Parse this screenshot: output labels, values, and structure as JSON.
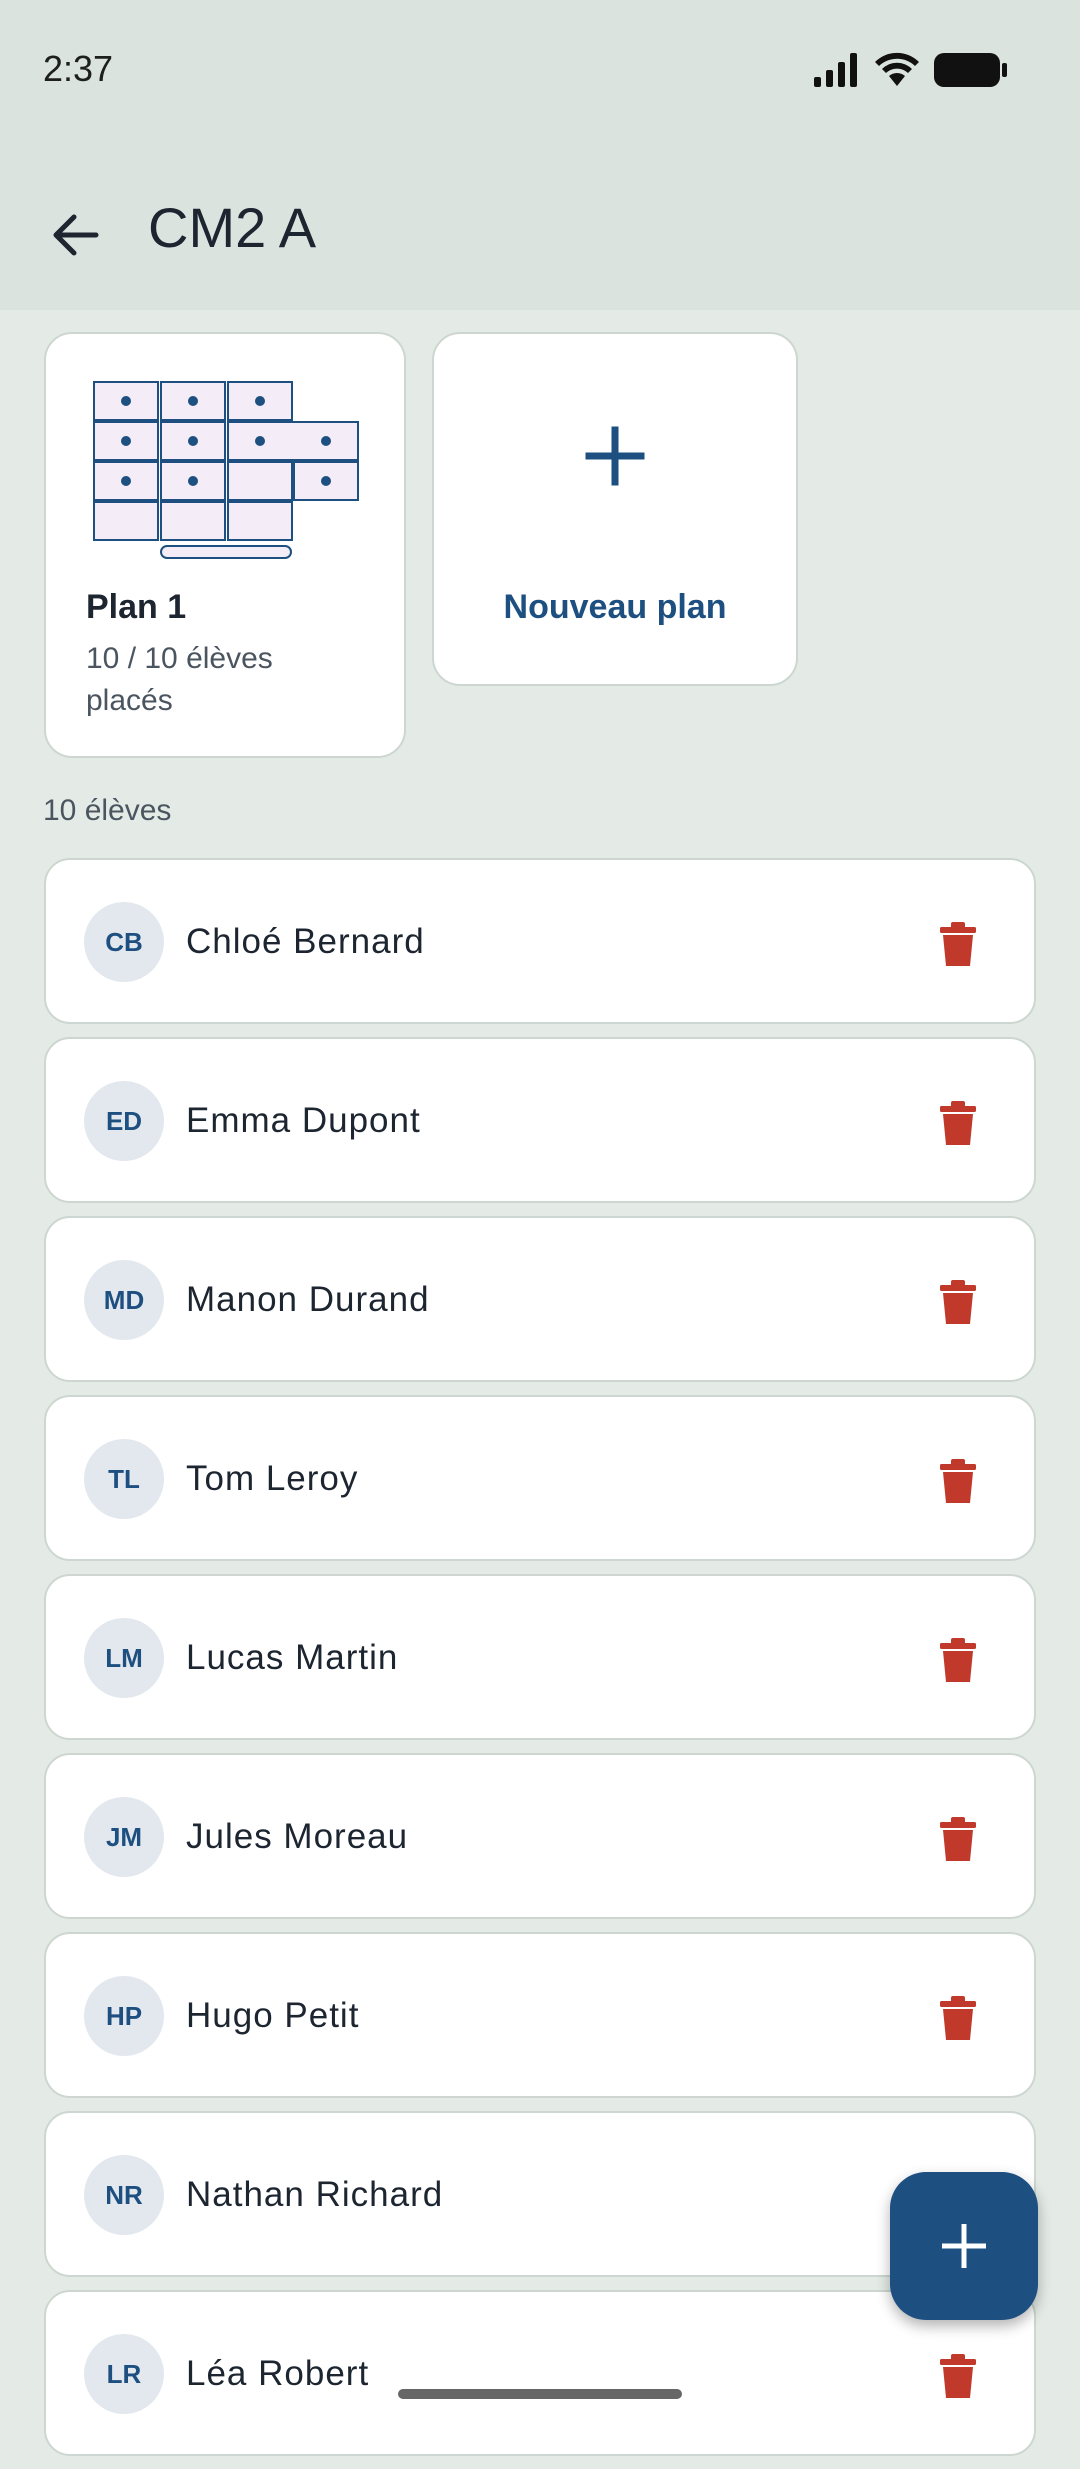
{
  "status_bar": {
    "time": "2:37"
  },
  "header": {
    "title": "CM2 A"
  },
  "plans": [
    {
      "name": "Plan 1",
      "subtitle": "10 / 10 élèves placés"
    }
  ],
  "new_plan": {
    "label": "Nouveau plan"
  },
  "students_count": "10 élèves",
  "students": [
    {
      "initials": "CB",
      "name": "Chloé Bernard"
    },
    {
      "initials": "ED",
      "name": "Emma Dupont"
    },
    {
      "initials": "MD",
      "name": "Manon Durand"
    },
    {
      "initials": "TL",
      "name": "Tom Leroy"
    },
    {
      "initials": "LM",
      "name": "Lucas Martin"
    },
    {
      "initials": "JM",
      "name": "Jules Moreau"
    },
    {
      "initials": "HP",
      "name": "Hugo Petit"
    },
    {
      "initials": "NR",
      "name": "Nathan Richard"
    },
    {
      "initials": "LR",
      "name": "Léa Robert"
    }
  ],
  "colors": {
    "accent": "#1d4f80",
    "delete": "#c0392b",
    "background": "#e4ebe6"
  },
  "icons": {
    "back": "arrow-left-icon",
    "add": "plus-icon",
    "delete": "trash-icon"
  }
}
